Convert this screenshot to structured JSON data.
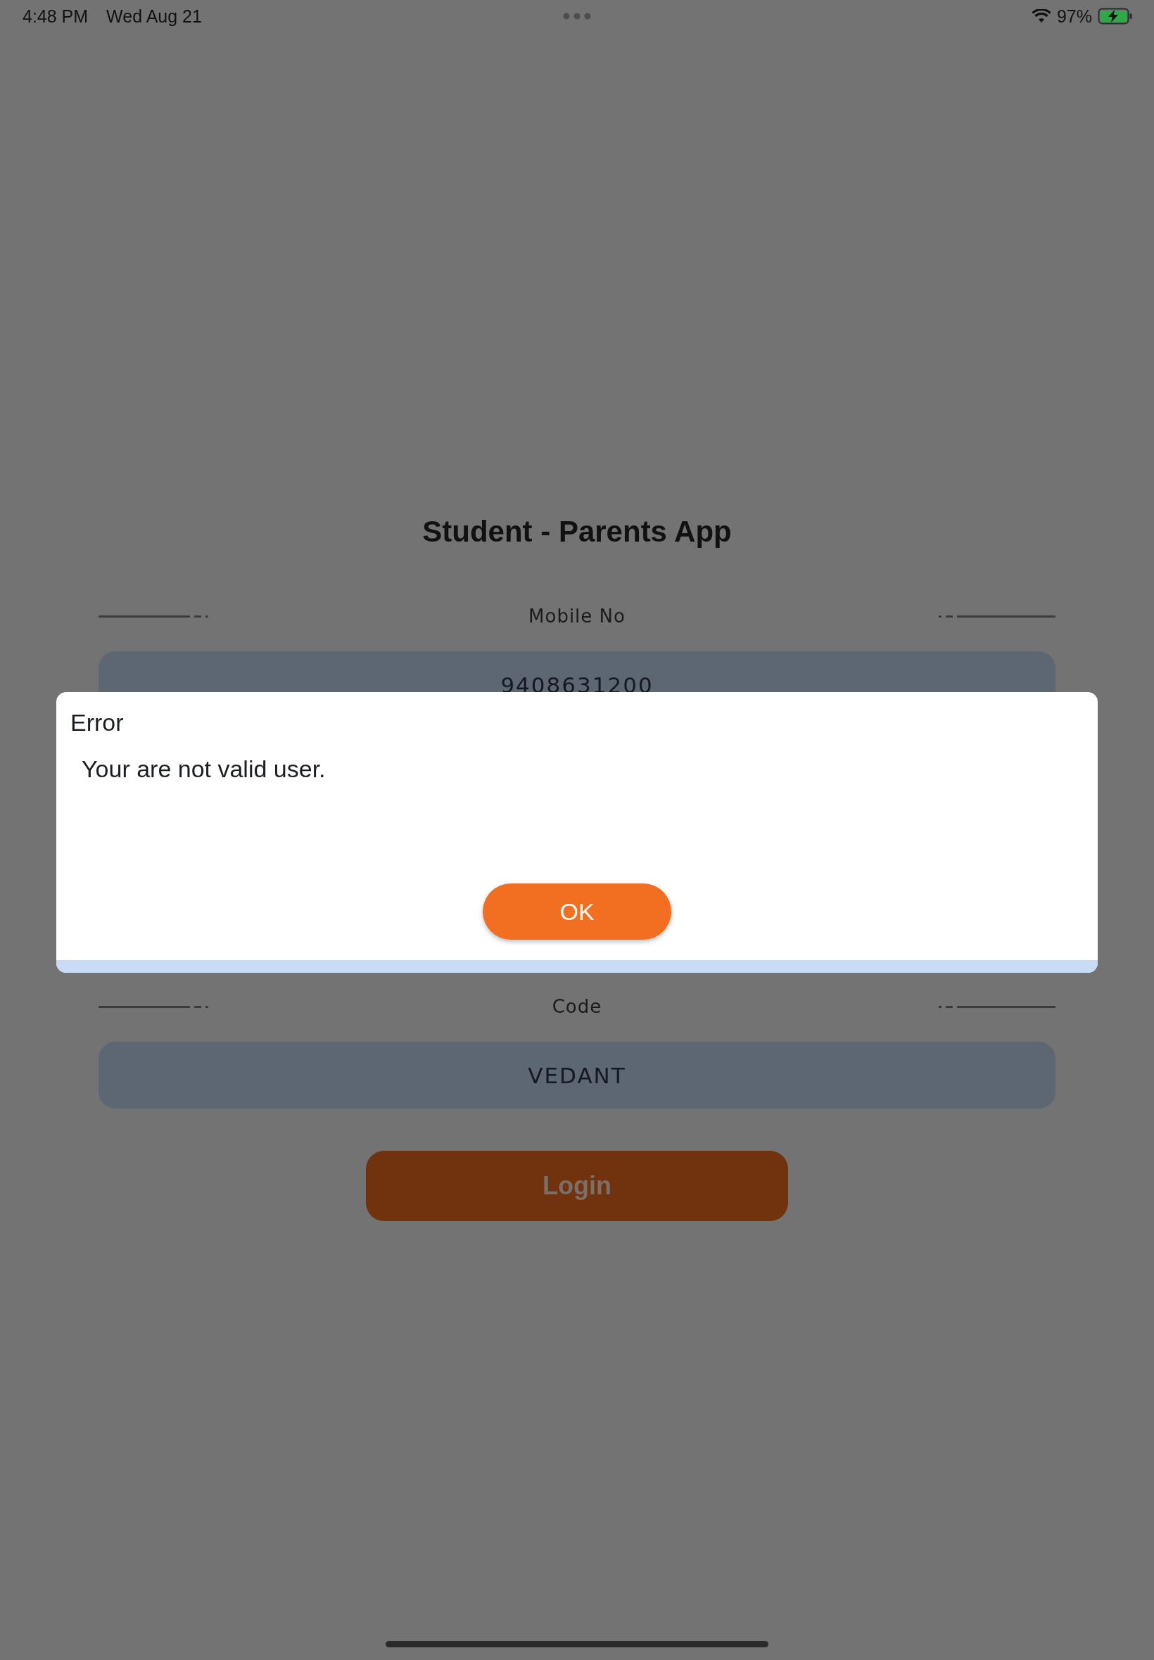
{
  "status_bar": {
    "time": "4:48 PM",
    "date": "Wed Aug 21",
    "battery": "97%"
  },
  "title": "Student - Parents App",
  "fields": [
    {
      "label": "Mobile No",
      "value": "9408631200"
    },
    {
      "label": "Code",
      "value": "VEDANT"
    }
  ],
  "login_button": "Login",
  "dialog": {
    "title": "Error",
    "message": "Your are not valid user.",
    "button": "OK"
  }
}
